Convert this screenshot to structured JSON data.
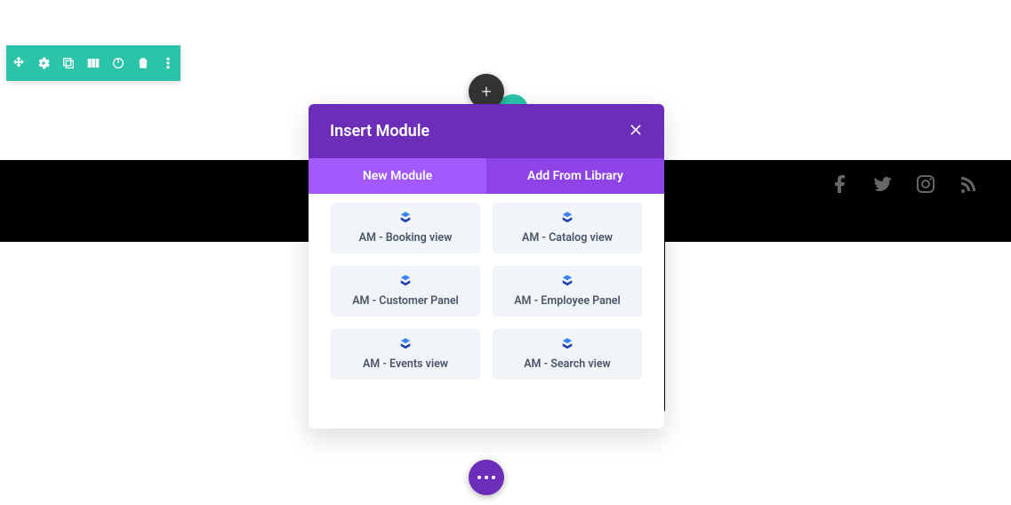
{
  "colors": {
    "accent_teal": "#2bc4a9",
    "accent_purple": "#6c2eb9",
    "tab_bg": "#8e43e7",
    "tab_active_bg": "#a259ff"
  },
  "toolbar": {
    "items": [
      "move",
      "settings",
      "duplicate",
      "columns",
      "power",
      "delete",
      "more"
    ]
  },
  "fab": {
    "add_label": "+"
  },
  "modal": {
    "title": "Insert Module",
    "close_label": "×",
    "tabs": [
      {
        "label": "New Module",
        "active": true
      },
      {
        "label": "Add From Library",
        "active": false
      }
    ],
    "modules": [
      {
        "label": "AM - Booking view"
      },
      {
        "label": "AM - Catalog view"
      },
      {
        "label": "AM - Customer Panel"
      },
      {
        "label": "AM - Employee Panel"
      },
      {
        "label": "AM - Events view"
      },
      {
        "label": "AM - Search view"
      }
    ]
  },
  "footer": {
    "social": [
      "facebook",
      "twitter",
      "instagram",
      "rss"
    ]
  }
}
